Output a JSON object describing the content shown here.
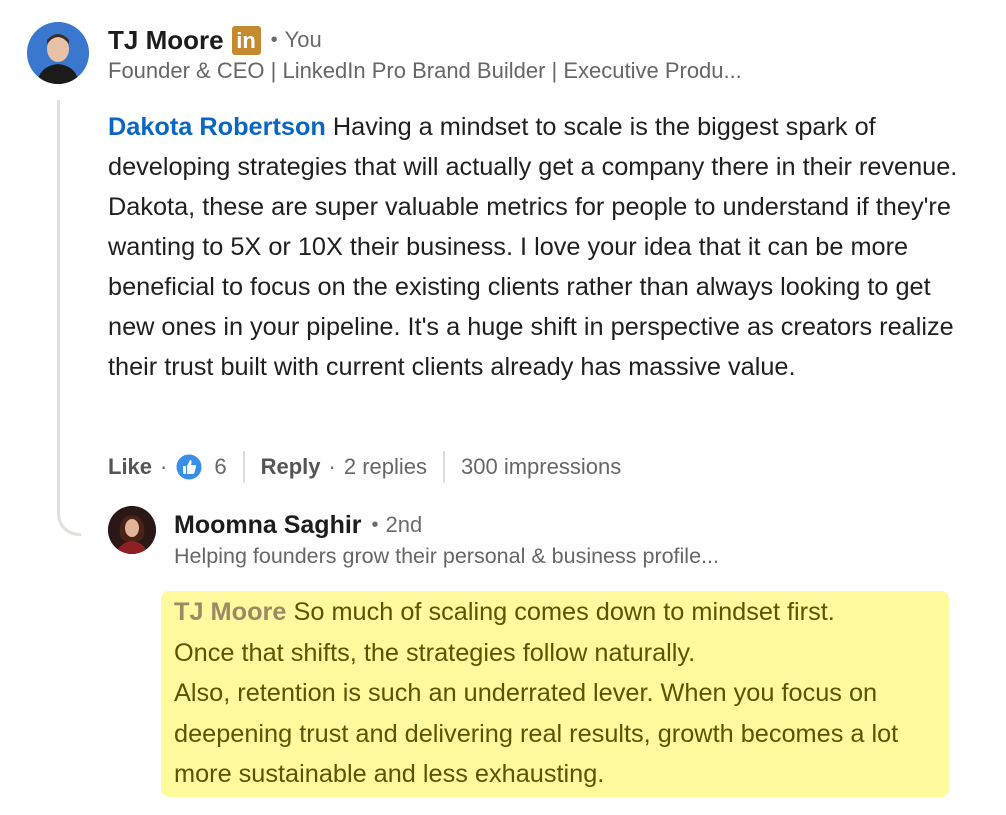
{
  "comment": {
    "author": "TJ Moore",
    "badge": "in",
    "relation": "You",
    "headline": "Founder & CEO | LinkedIn Pro Brand Builder | Executive Produ...",
    "mention": "Dakota Robertson",
    "body": " Having a mindset to scale is the biggest spark of developing strategies that will actually get a company there in their revenue. Dakota, these are super valuable metrics for people to understand if they're wanting to 5X or 10X their business. I love your idea that it can be more beneficial to focus on the existing clients rather than always looking to get new ones in your pipeline. It's a huge shift in perspective as creators realize their trust built with current clients already has massive value.",
    "actions": {
      "like_label": "Like",
      "like_count": "6",
      "reply_label": "Reply",
      "replies": "2 replies",
      "impressions": "300 impressions"
    }
  },
  "reply": {
    "author": "Moomna Saghir",
    "relation": "2nd",
    "headline": "Helping founders grow their personal & business profile...",
    "mention": "TJ Moore",
    "line1": " So much of scaling comes down to mindset first.",
    "line2": "Once that shifts, the strategies follow naturally.",
    "line3": "Also, retention is such an underrated lever. When you focus on deepening trust and delivering real results, growth becomes a lot more sustainable and less exhausting.",
    "highlight_color": "#fefa9d"
  },
  "colors": {
    "mention_blue": "#0a66c2",
    "linkedin_badge": "#c68a2e"
  }
}
